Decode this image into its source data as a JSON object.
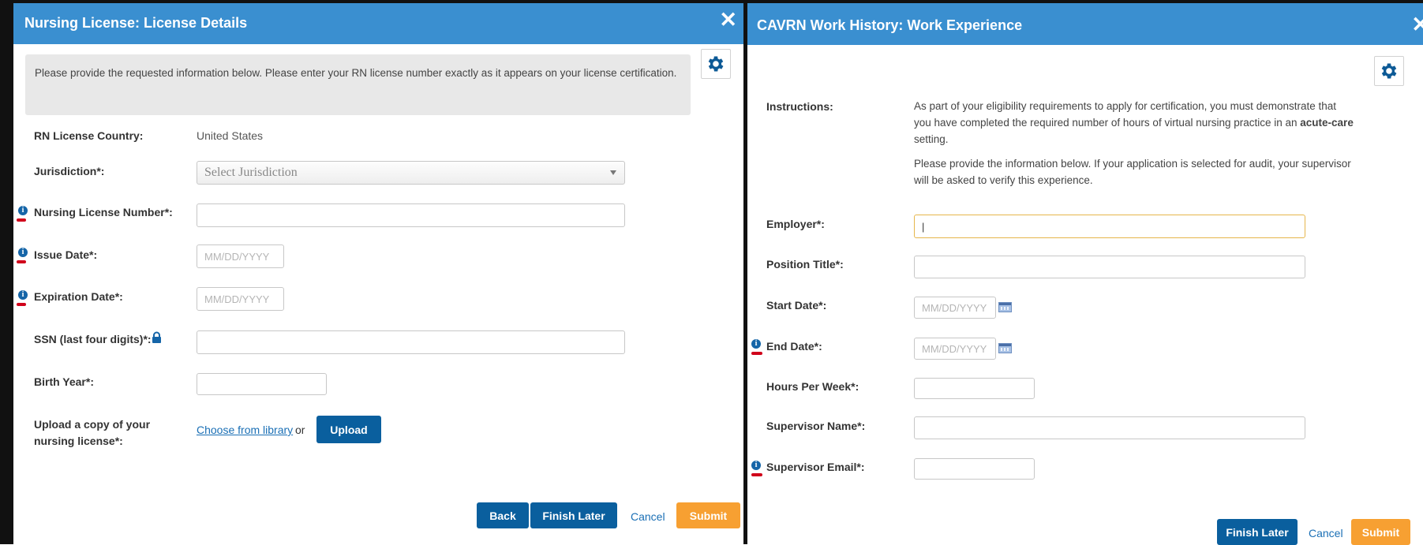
{
  "left": {
    "title": "Nursing License: License Details",
    "close": "✕",
    "info_text": "Please provide the requested information below. Please enter your RN license number exactly as it appears on your license certification.",
    "country_label": "RN License Country:",
    "country_value": "United States",
    "jurisdiction_label": "Jurisdiction*:",
    "jurisdiction_value": "Select Jurisdiction",
    "license_number_label": "Nursing License Number*:",
    "issue_date_label": "Issue Date*:",
    "issue_date_placeholder": "MM/DD/YYYY",
    "expiration_date_label": "Expiration Date*:",
    "expiration_date_placeholder": "MM/DD/YYYY",
    "ssn_label": "SSN (last four digits)*:",
    "birth_year_label": "Birth Year*:",
    "upload_label": "Upload a copy of your nursing license*:",
    "choose_link": "Choose from library",
    "or_text": "or",
    "upload_button": "Upload",
    "back_button": "Back",
    "finish_later_button": "Finish Later",
    "cancel_link": "Cancel",
    "submit_button": "Submit"
  },
  "right": {
    "title": "CAVRN Work History: Work Experience",
    "close": "✕",
    "instructions_label": "Instructions:",
    "instructions_p1_a": "As part of your eligibility requirements to apply for certification, you must demonstrate that you have completed the required number of hours of virtual nursing practice in an ",
    "instructions_p1_bold": "acute-care",
    "instructions_p1_b": " setting.",
    "instructions_p2": "Please provide the information below. If your application is selected for audit, your supervisor will be asked to verify this experience.",
    "employer_label": "Employer*:",
    "employer_value": "|",
    "position_label": "Position Title*:",
    "start_date_label": "Start Date*:",
    "start_date_placeholder": "MM/DD/YYYY",
    "end_date_label": "End Date*:",
    "end_date_placeholder": "MM/DD/YYYY",
    "hours_label": "Hours Per Week*:",
    "supervisor_name_label": "Supervisor Name*:",
    "supervisor_email_label": "Supervisor Email*:",
    "finish_later_button": "Finish Later",
    "cancel_link": "Cancel",
    "submit_button": "Submit"
  },
  "colors": {
    "title_bar": "#3a8fd0",
    "primary_button": "#0a5f9e",
    "submit_button": "#f7a032",
    "info_icon": "#1565a8",
    "annotation_red": "#d0021b"
  },
  "icons": [
    "close-icon",
    "gear-icon",
    "info-icon",
    "lock-icon",
    "calendar-icon"
  ]
}
